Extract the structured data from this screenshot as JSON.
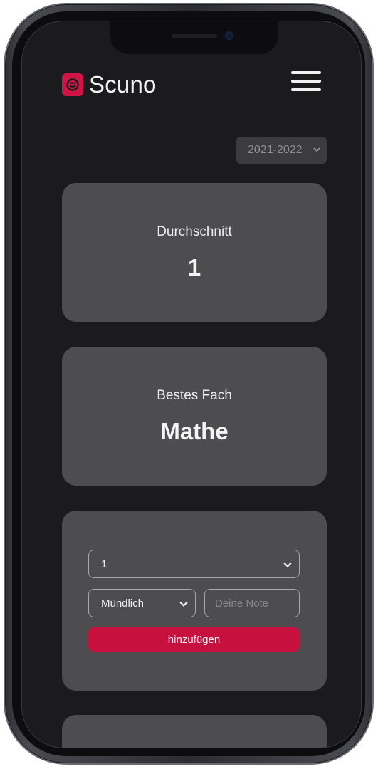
{
  "app": {
    "brand_name": "Scuno",
    "brand_color": "#cf1446",
    "menu_icon": "hamburger-menu-icon",
    "logo_icon": "scuno-logo-icon"
  },
  "year_filter": {
    "selected": "2021-2022"
  },
  "average_card": {
    "label": "Durchschnitt",
    "value": "1"
  },
  "best_subject_card": {
    "label": "Bestes Fach",
    "value": "Mathe"
  },
  "add_grade_form": {
    "subject_select_value": "1",
    "type_select_value": "Mündlich",
    "grade_input_value": "",
    "grade_input_placeholder": "Deine Note",
    "submit_label": "hinzufügen",
    "submit_color": "#c8103f"
  }
}
